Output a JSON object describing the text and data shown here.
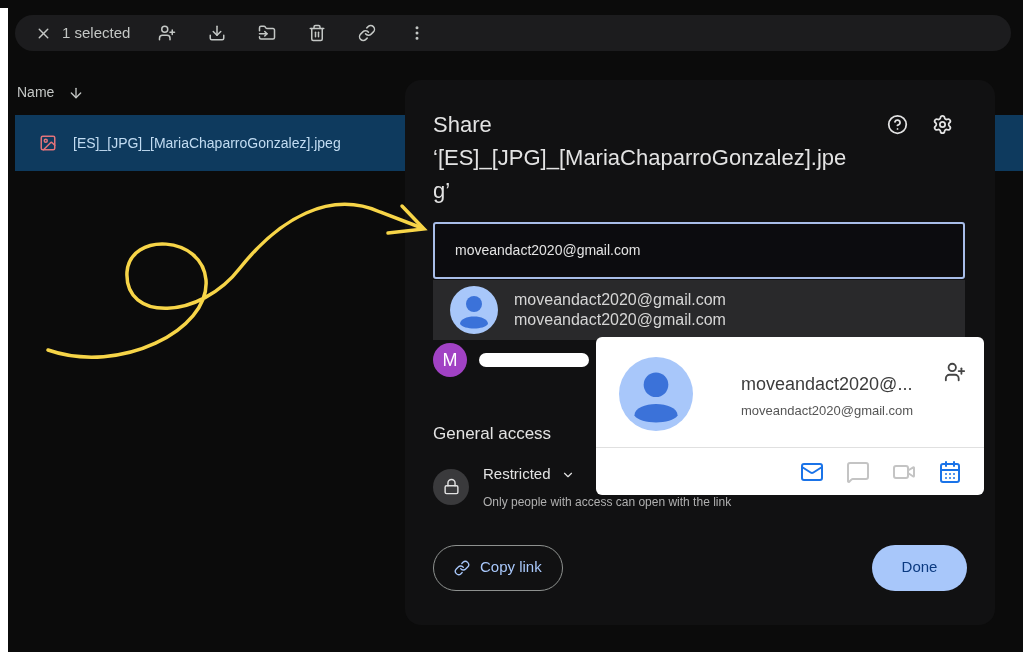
{
  "toolbar": {
    "selection_count": "1 selected"
  },
  "file_list": {
    "column": "Name",
    "rows": [
      {
        "name": "[ES]_[JPG]_[MariaChaparroGonzalez].jpeg",
        "selected": true
      }
    ]
  },
  "share_dialog": {
    "title": "Share",
    "file_name": "‘[ES]_[JPG]_[MariaChaparroGonzalez].jpeg’",
    "input": {
      "value": "moveandact2020@gmail.com"
    },
    "suggestion": {
      "name": "moveandact2020@gmail.com",
      "email": "moveandact2020@gmail.com"
    },
    "people": [
      {
        "initial": "M",
        "color": "#a142c4",
        "redacted": true
      }
    ],
    "general_access": {
      "heading": "General access",
      "level": "Restricted",
      "description": "Only people with access can open with the link"
    },
    "copy_link": "Copy link",
    "done": "Done"
  },
  "contact_card": {
    "name": "moveandact2020@...",
    "email": "moveandact2020@gmail.com",
    "actions": [
      {
        "kind": "mail",
        "disabled": false
      },
      {
        "kind": "chat",
        "disabled": true
      },
      {
        "kind": "video",
        "disabled": true
      },
      {
        "kind": "calendar",
        "disabled": false
      }
    ]
  }
}
